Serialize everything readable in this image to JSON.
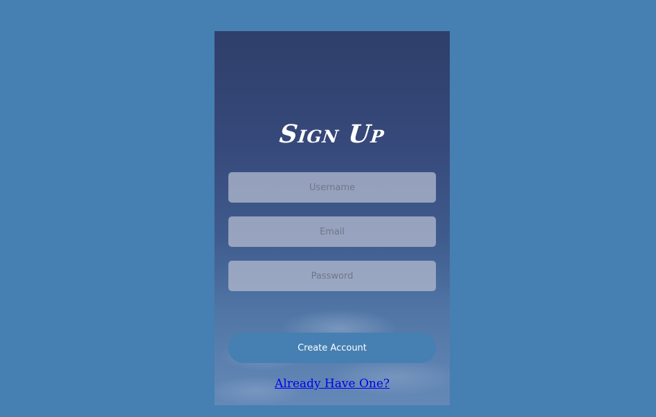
{
  "form": {
    "title": "Sign Up",
    "username_placeholder": "Username",
    "email_placeholder": "Email",
    "password_placeholder": "Password",
    "submit_label": "Create Account",
    "login_link": "Already Have One?"
  },
  "colors": {
    "page_background": "#467fb2",
    "button_background": "#467fb2",
    "link": "#0000ee"
  }
}
